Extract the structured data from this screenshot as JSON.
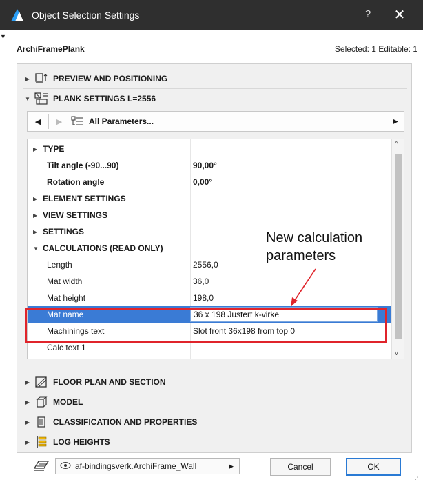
{
  "window": {
    "title": "Object Selection Settings",
    "help_label": "?",
    "close_label": "✕"
  },
  "header": {
    "object_name": "ArchiFramePlank",
    "selection_info": "Selected: 1 Editable: 1"
  },
  "sections": {
    "preview": "PREVIEW AND POSITIONING",
    "plank_settings": "PLANK SETTINGS L=2556",
    "floor_plan": "FLOOR PLAN AND SECTION",
    "model": "MODEL",
    "classification": "CLASSIFICATION AND PROPERTIES",
    "log_heights": "LOG HEIGHTS"
  },
  "navbar": {
    "label": "All Parameters..."
  },
  "params": [
    {
      "label": "TYPE",
      "type": "group",
      "expanded": false
    },
    {
      "label": "Tilt angle (-90...90)",
      "value": "90,00°",
      "style": "bold"
    },
    {
      "label": "Rotation angle",
      "value": "0,00°",
      "style": "bold"
    },
    {
      "label": "ELEMENT SETTINGS",
      "type": "group",
      "expanded": false
    },
    {
      "label": "VIEW SETTINGS",
      "type": "group",
      "expanded": false
    },
    {
      "label": "SETTINGS",
      "type": "group",
      "expanded": false
    },
    {
      "label": "CALCULATIONS (READ ONLY)",
      "type": "group",
      "expanded": true
    },
    {
      "label": "Length",
      "value": "2556,0"
    },
    {
      "label": "Mat width",
      "value": "36,0"
    },
    {
      "label": "Mat height",
      "value": "198,0"
    },
    {
      "label": "Mat name",
      "value": "36 x 198 Justert k-virke",
      "selected": true
    },
    {
      "label": "Machinings text",
      "value": "Slot front 36x198 from top 0"
    },
    {
      "label": "Calc text 1",
      "value": ""
    }
  ],
  "annotation": {
    "line1": "New calculation",
    "line2": "parameters",
    "color": "#e0242b"
  },
  "footer": {
    "favorite": "af-bindingsverk.ArchiFrame_Wall",
    "cancel_label": "Cancel",
    "ok_label": "OK"
  },
  "colors": {
    "selection": "#3a7bd5",
    "titlebar": "#2f2f2f"
  }
}
